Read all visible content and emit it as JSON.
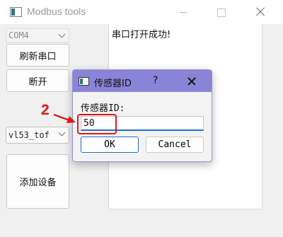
{
  "window": {
    "title": "Modbus tools"
  },
  "left_panel": {
    "port_value": "COM4",
    "refresh_label": "刷新串口",
    "disconnect_label": "断开",
    "device_value": "vl53_tof",
    "add_device_label": "添加设备"
  },
  "log": {
    "text": "串口打开成功!"
  },
  "dialog": {
    "title": "传感器ID",
    "help": "?",
    "label": "传感器ID:",
    "input_value": "50",
    "ok_label": "OK",
    "cancel_label": "Cancel"
  },
  "annotation": {
    "step_number": "2",
    "color": "#e0181a"
  },
  "colors": {
    "dialog_titlebar": "#8a84d8",
    "focus_blue": "#1f6fc5"
  }
}
